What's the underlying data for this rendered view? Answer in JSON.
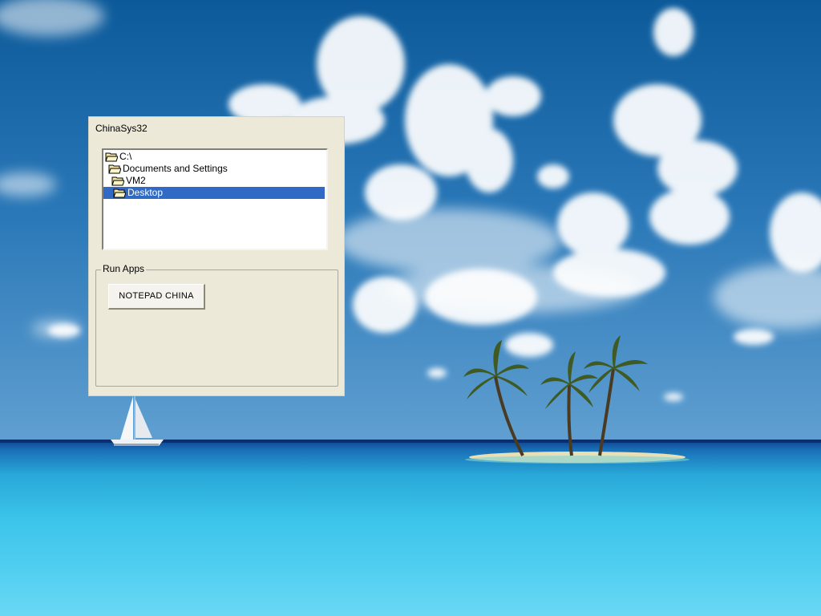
{
  "window": {
    "title": "ChinaSys32"
  },
  "tree": {
    "items": [
      {
        "label": "C:\\",
        "icon": "folder-open-icon"
      },
      {
        "label": "Documents and Settings",
        "icon": "folder-open-icon"
      },
      {
        "label": "VM2",
        "icon": "folder-open-icon"
      },
      {
        "label": "Desktop",
        "icon": "folder-open-icon",
        "selected": true
      }
    ]
  },
  "run_apps": {
    "group_label": "Run Apps",
    "buttons": [
      {
        "label": "NOTEPAD CHINA"
      }
    ]
  },
  "colors": {
    "selection": "#316ac5",
    "window_bg": "#ece9d8",
    "sky": "#2a78b8",
    "sea": "#3cc4ea"
  }
}
